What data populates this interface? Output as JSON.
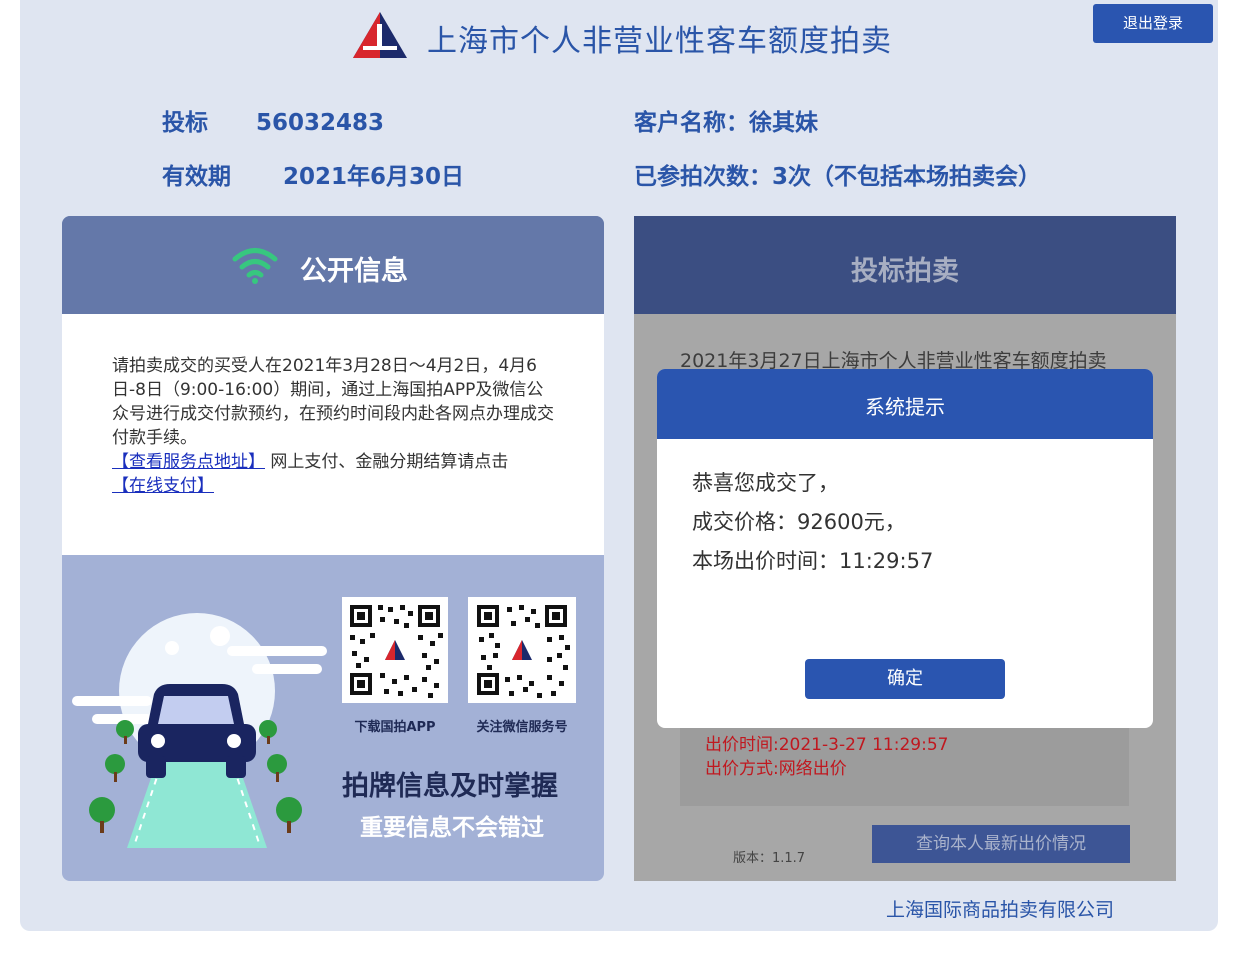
{
  "header": {
    "title": "上海市个人非营业性客车额度拍卖",
    "logout_label": "退出登录"
  },
  "bidder": {
    "bid_label": "投标",
    "bid_number": "56032483",
    "validity_label": "有效期",
    "validity_value": "2021年6月30日",
    "customer_label": "客户名称：",
    "customer_name": "徐其妹",
    "participation_label": "已参拍次数：",
    "participation_value": "3次（不包括本场拍卖会）"
  },
  "public_info": {
    "title": "公开信息",
    "notice_text": "请拍卖成交的买受人在2021年3月28日～4月2日，4月6日-8日（9:00-16:00）期间，通过上海国拍APP及微信公众号进行成交付款预约，在预约时间段内赴各网点办理成交付款手续。",
    "service_link": "【查看服务点地址】",
    "pay_text": " 网上支付、金融分期结算请点击",
    "online_pay_link": "【在线支付】",
    "qr_app_label": "下载国拍APP",
    "qr_wechat_label": "关注微信服务号",
    "slogan_main": "拍牌信息及时掌握",
    "slogan_sub": "重要信息不会错过"
  },
  "bidding": {
    "title": "投标拍卖",
    "auction_line": "2021年3月27日上海市个人非营业性客车额度拍卖",
    "bid_time": "出价时间:2021-3-27 11:29:57",
    "bid_method": "出价方式:网络出价",
    "version": "版本：1.1.7",
    "query_button": "查询本人最新出价情况"
  },
  "modal": {
    "title": "系统提示",
    "line1": "恭喜您成交了，",
    "line2": "成交价格：92600元，",
    "line3": "本场出价时间：11:29:57",
    "ok_label": "确定"
  },
  "footer": {
    "company": "上海国际商品拍卖有限公司"
  },
  "colors": {
    "brand_blue": "#2a55b0",
    "panel_bg": "#dfe5f1",
    "alert_red": "#c0181f",
    "wifi_green": "#37c77f"
  }
}
